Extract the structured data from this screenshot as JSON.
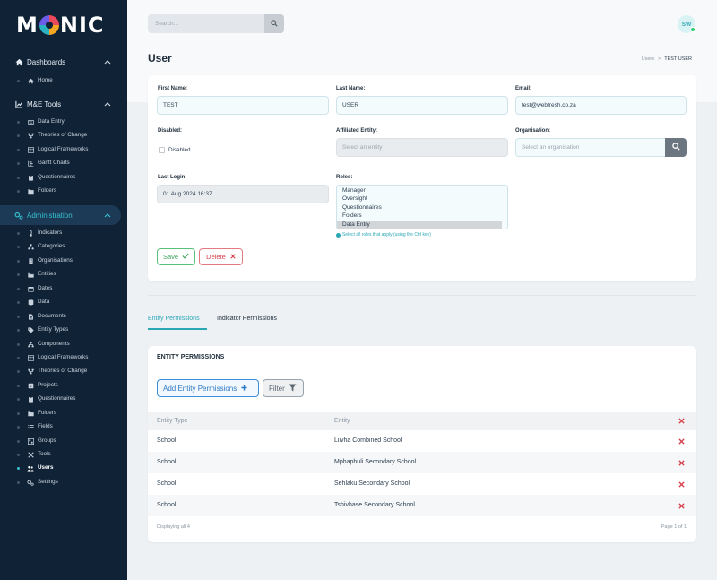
{
  "app": {
    "logo_text": "MONIC"
  },
  "search": {
    "placeholder": "Search..."
  },
  "user_avatar": {
    "initials": "SW"
  },
  "page": {
    "title": "User"
  },
  "breadcrumb": {
    "parent": "Users",
    "separator": ">",
    "current": "TEST USER"
  },
  "sidebar": {
    "sections": [
      {
        "label": "Dashboards",
        "icon": "home-icon",
        "items": [
          {
            "label": "Home",
            "icon": "home-icon"
          }
        ]
      },
      {
        "label": "M&E Tools",
        "icon": "chart-icon",
        "items": [
          {
            "label": "Data Entry",
            "icon": "keyboard-icon"
          },
          {
            "label": "Theories of Change",
            "icon": "sitemap-icon"
          },
          {
            "label": "Logical Frameworks",
            "icon": "table-icon"
          },
          {
            "label": "Gantt Charts",
            "icon": "gantt-icon"
          },
          {
            "label": "Questionnaires",
            "icon": "clipboard-icon"
          },
          {
            "label": "Folders",
            "icon": "folder-icon"
          }
        ]
      },
      {
        "label": "Administration",
        "icon": "cogs-icon",
        "active": true,
        "items": [
          {
            "label": "Indicators",
            "icon": "thermometer-icon"
          },
          {
            "label": "Categories",
            "icon": "hierarchy-icon"
          },
          {
            "label": "Organisations",
            "icon": "building-icon"
          },
          {
            "label": "Entities",
            "icon": "industry-icon"
          },
          {
            "label": "Dates",
            "icon": "calendar-icon"
          },
          {
            "label": "Data",
            "icon": "database-icon"
          },
          {
            "label": "Documents",
            "icon": "file-icon"
          },
          {
            "label": "Entity Types",
            "icon": "tags-icon"
          },
          {
            "label": "Components",
            "icon": "hierarchy-icon"
          },
          {
            "label": "Logical Frameworks",
            "icon": "table-icon"
          },
          {
            "label": "Theories of Change",
            "icon": "sitemap-icon"
          },
          {
            "label": "Projects",
            "icon": "projects-icon"
          },
          {
            "label": "Questionnaires",
            "icon": "clipboard-icon"
          },
          {
            "label": "Folders",
            "icon": "folder-icon"
          },
          {
            "label": "Fields",
            "icon": "list-icon"
          },
          {
            "label": "Groups",
            "icon": "groups-icon"
          },
          {
            "label": "Tools",
            "icon": "tools-icon"
          },
          {
            "label": "Users",
            "icon": "users-icon",
            "active": true
          },
          {
            "label": "Settings",
            "icon": "cogs-icon"
          }
        ]
      }
    ]
  },
  "form": {
    "first_name": {
      "label": "First Name:",
      "value": "TEST"
    },
    "last_name": {
      "label": "Last Name:",
      "value": "USER"
    },
    "email": {
      "label": "Email:",
      "value": "test@webfresh.co.za"
    },
    "disabled": {
      "label": "Disabled:",
      "checkbox_label": "Disabled",
      "checked": false
    },
    "affiliated_entity": {
      "label": "Affiliated Entity:",
      "placeholder": "Select an entity"
    },
    "organisation": {
      "label": "Organisation:",
      "placeholder": "Select an organisation"
    },
    "last_login": {
      "label": "Last Login:",
      "value": "01 Aug 2024 16:37"
    },
    "roles": {
      "label": "Roles:",
      "options": [
        "Manager",
        "Oversight",
        "Questionnaires",
        "Folders",
        "Data Entry"
      ],
      "selected": "Data Entry",
      "hint": "Select all roles that apply (using the Ctrl key)"
    },
    "save_label": "Save",
    "delete_label": "Delete"
  },
  "tabs": [
    {
      "label": "Entity Permissions",
      "active": true
    },
    {
      "label": "Indicator Permissions",
      "active": false
    }
  ],
  "permissions": {
    "title": "ENTITY PERMISSIONS",
    "add_label": "Add Entity Permissions",
    "filter_label": "Filter",
    "columns": [
      "Entity Type",
      "Entity"
    ],
    "rows": [
      {
        "entity_type": "School",
        "entity": "Liivha Combined School"
      },
      {
        "entity_type": "School",
        "entity": "Mphaphuli Secondary School"
      },
      {
        "entity_type": "School",
        "entity": "Sehlaku Secondary School"
      },
      {
        "entity_type": "School",
        "entity": "Tshivhase Secondary School"
      }
    ],
    "footer_left": "Displaying all 4",
    "footer_right": "Page 1 of 1"
  },
  "colors": {
    "sidebar_bg": "#0f2236",
    "accent": "#2aa7b5",
    "save": "#3aa35a",
    "delete": "#d6404c",
    "add": "#2b78c2"
  }
}
